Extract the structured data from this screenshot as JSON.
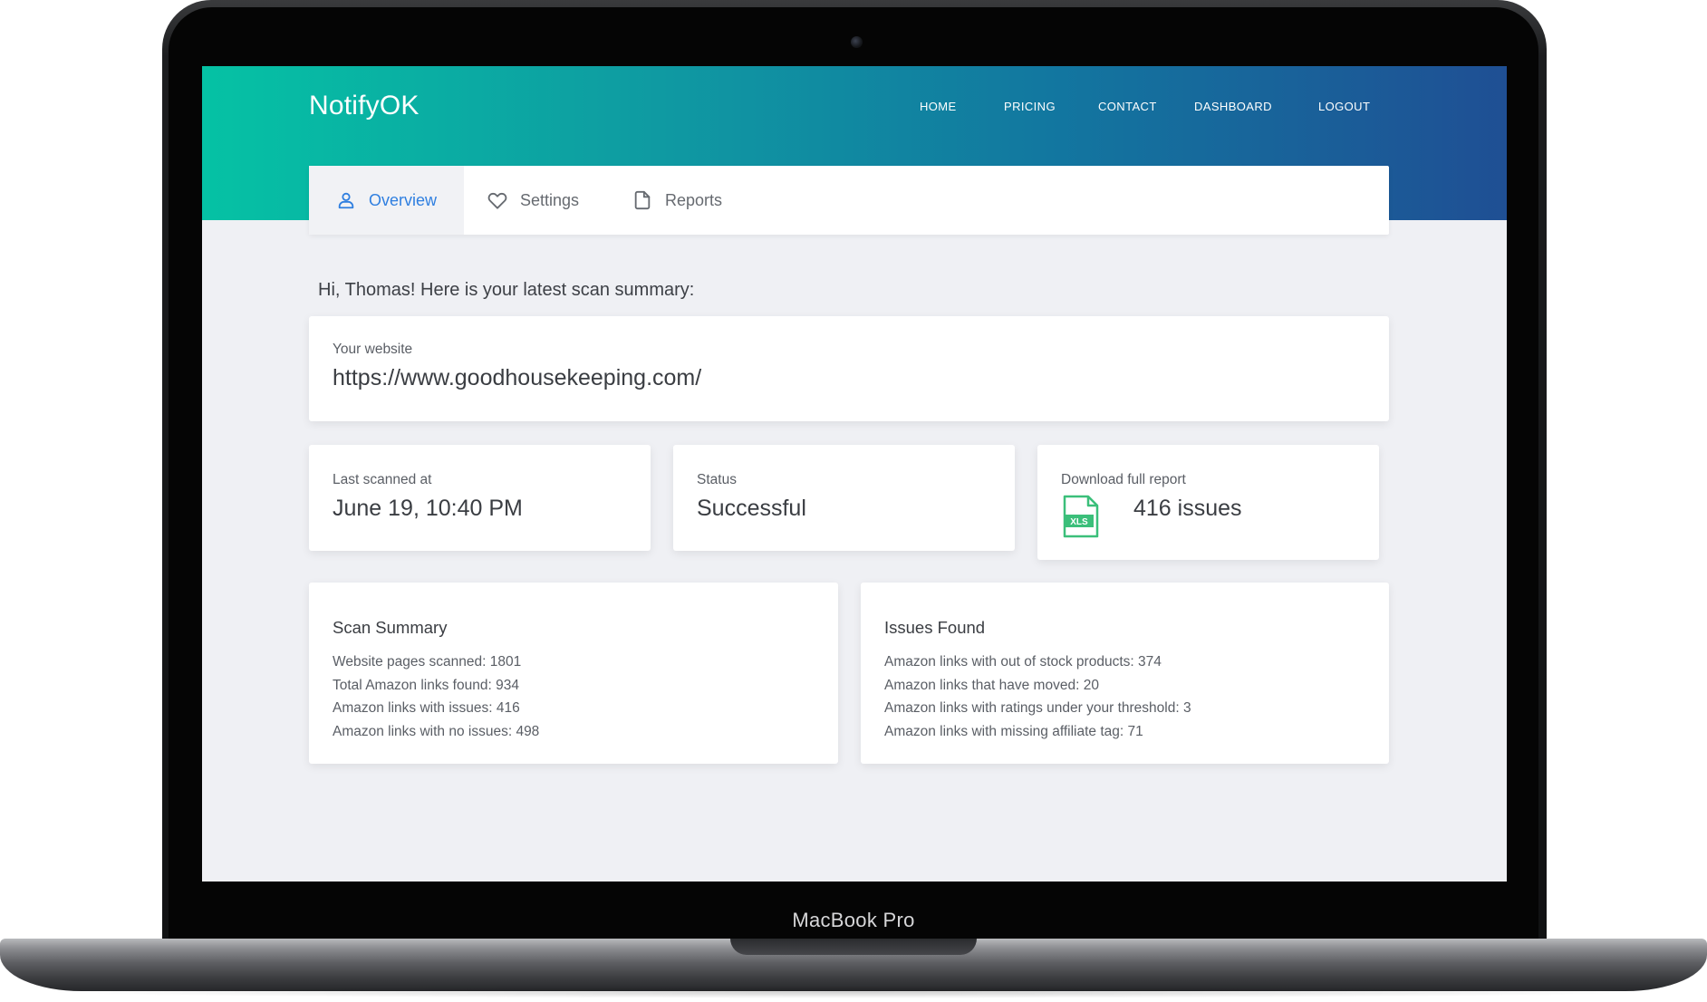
{
  "device": {
    "model_label": "MacBook Pro"
  },
  "app": {
    "name": "NotifyOK"
  },
  "nav": {
    "items": [
      {
        "label": "HOME"
      },
      {
        "label": "PRICING"
      },
      {
        "label": "CONTACT"
      },
      {
        "label": "DASHBOARD"
      },
      {
        "label": "LOGOUT"
      }
    ]
  },
  "tabs": [
    {
      "label": "Overview",
      "icon": "user-icon",
      "active": true
    },
    {
      "label": "Settings",
      "icon": "heart-icon",
      "active": false
    },
    {
      "label": "Reports",
      "icon": "file-icon",
      "active": false
    }
  ],
  "greeting": "Hi, Thomas! Here is your latest scan summary:",
  "website": {
    "label": "Your website",
    "value": "https://www.goodhousekeeping.com/"
  },
  "last_scanned": {
    "label": "Last scanned at",
    "value": "June 19, 10:40 PM"
  },
  "status": {
    "label": "Status",
    "value": "Successful"
  },
  "report": {
    "label": "Download full report",
    "value": "416 issues",
    "icon": "xls-file-icon",
    "icon_text": "XLS"
  },
  "scan_summary": {
    "title": "Scan Summary",
    "items": [
      "Website pages scanned: 1801",
      "Total Amazon links found: 934",
      "Amazon links with issues: 416",
      "Amazon links with no issues: 498"
    ]
  },
  "issues_found": {
    "title": "Issues Found",
    "items": [
      "Amazon links with out of stock products: 374",
      "Amazon links that have moved: 20",
      "Amazon links with ratings under your threshold: 3",
      "Amazon links with missing affiliate tag: 71"
    ]
  },
  "colors": {
    "header_gradient_start": "#05c2a4",
    "header_gradient_end": "#1f4f94",
    "accent": "#2f7fe0",
    "page_background": "#eff0f4",
    "xls_green": "#3bbf7a"
  }
}
